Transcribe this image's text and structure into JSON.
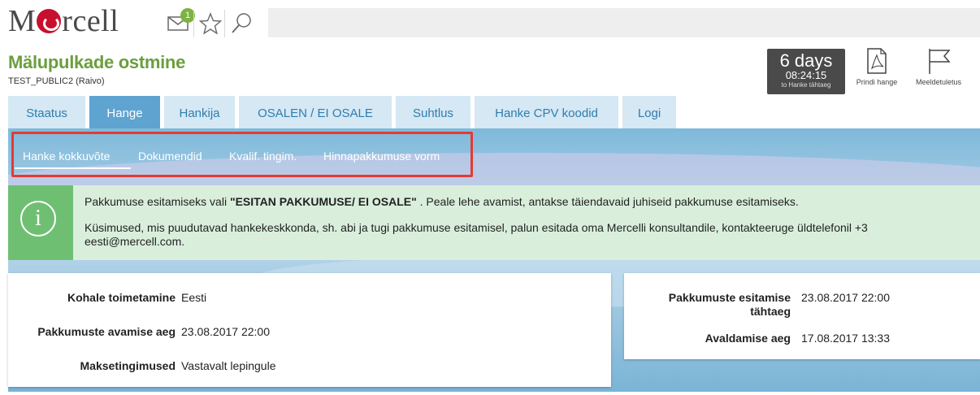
{
  "header": {
    "logo": "Mercell",
    "notification_count": "1"
  },
  "tender": {
    "title": "Mälupulkade ostmine",
    "subtitle": "TEST_PUBLIC2 (Raivo)"
  },
  "countdown": {
    "days": "6 days",
    "time": "08:24:15",
    "to": "to Hanke tähtaeg"
  },
  "actions": {
    "print": "Prindi hange",
    "reminder": "Meeldetuletus"
  },
  "tabs": [
    {
      "label": "Staatus"
    },
    {
      "label": "Hange"
    },
    {
      "label": "Hankija"
    },
    {
      "label": "OSALEN / EI OSALE"
    },
    {
      "label": "Suhtlus"
    },
    {
      "label": "Hanke CPV koodid"
    },
    {
      "label": "Logi"
    }
  ],
  "subnav": [
    {
      "label": "Hanke kokkuvõte"
    },
    {
      "label": "Dokumendid"
    },
    {
      "label": "Kvalif. tingim."
    },
    {
      "label": "Hinnapakkumuse vorm"
    }
  ],
  "info": {
    "line1_pre": "Pakkumuse esitamiseks vali ",
    "line1_bold": "\"ESITAN PAKKUMUSE/ EI OSALE\"",
    "line1_post": " . Peale lehe avamist, antakse täiendavaid juhiseid pakkumuse esitamiseks.",
    "line2": "Küsimused, mis puudutavad hankekeskkonda, sh. abi ja tugi pakkumuse esitamisel, palun esitada oma Mercelli konsultandile, kontakteeruge üldtelefonil +3",
    "line3": "eesti@mercell.com."
  },
  "details_left": [
    {
      "label": "Kohale toimetamine",
      "value": "Eesti"
    },
    {
      "label": "Pakkumuste avamise aeg",
      "value": "23.08.2017 22:00"
    },
    {
      "label": "Maksetingimused",
      "value": "Vastavalt lepingule"
    }
  ],
  "details_right": [
    {
      "label_line1": "Pakkumuste esitamise",
      "label_line2": "tähtaeg",
      "value": "23.08.2017 22:00"
    },
    {
      "label": "Avaldamise aeg",
      "value": "17.08.2017 13:33"
    }
  ],
  "colors": {
    "accent_green": "#6b9e3e",
    "tab_active": "#5fa3d0",
    "tab_inactive": "#d5e8f3",
    "highlight_border": "#e53935",
    "info_bg": "#d9efdc"
  }
}
